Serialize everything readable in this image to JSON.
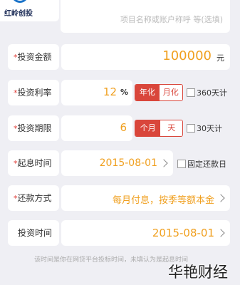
{
  "logo": {
    "text": "红岭创投",
    "color": "#1a73c9"
  },
  "project_name": {
    "placeholder": "项目名称或账户称呼 等(选填)"
  },
  "amount": {
    "label": "投资金额",
    "required": "*",
    "value": "100000",
    "unit": "元"
  },
  "rate": {
    "label": "投资利率",
    "required": "*",
    "value": "12",
    "unit": "%",
    "options": [
      "年化",
      "月化"
    ],
    "selected": "年化",
    "checkbox": "360天计"
  },
  "period": {
    "label": "投资期限",
    "required": "*",
    "value": "6",
    "options": [
      "个月",
      "天"
    ],
    "selected": "个月",
    "checkbox": "30天计"
  },
  "start_date": {
    "label": "起息时间",
    "required": "*",
    "value": "2015-08-01",
    "checkbox": "固定还款日"
  },
  "repay": {
    "label": "还款方式",
    "required": "*",
    "value": "每月付息，按季等额本金"
  },
  "invest_date": {
    "label": "投资时间",
    "value": "2015-08-01"
  },
  "hint": {
    "text": "该时间是你在网贷平台投标时间，未填认为是起息时间"
  },
  "watermark": {
    "text": "华艳财经"
  },
  "colors": {
    "accent": "#d9463b",
    "value": "#f0a020",
    "background": "#efeff4"
  }
}
